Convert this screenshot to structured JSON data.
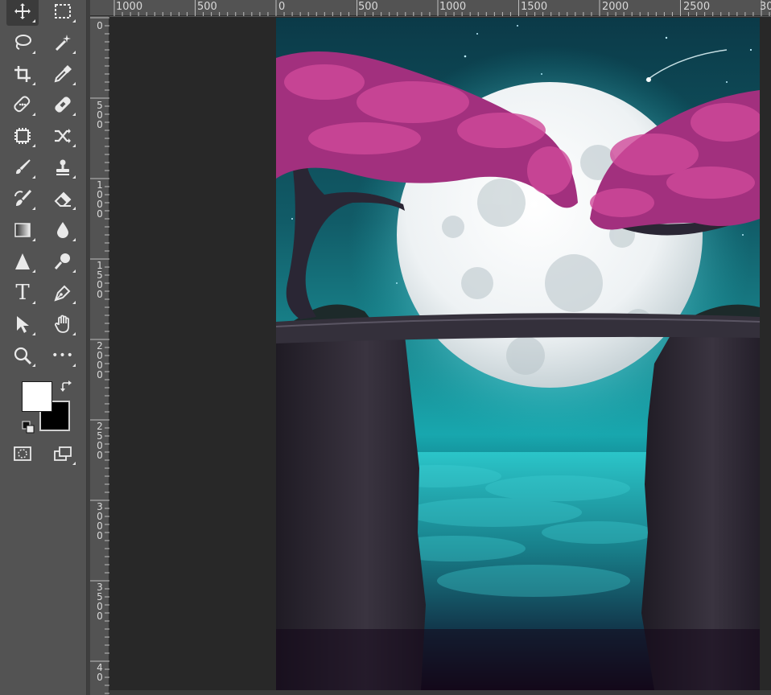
{
  "toolbar": {
    "tools": [
      {
        "name": "move-tool",
        "icon": "move-icon",
        "selected": true
      },
      {
        "name": "marquee-tool",
        "icon": "rectangular-marquee-icon"
      },
      {
        "name": "lasso-tool",
        "icon": "lasso-icon"
      },
      {
        "name": "magic-wand-tool",
        "icon": "magic-wand-icon"
      },
      {
        "name": "crop-tool",
        "icon": "crop-icon"
      },
      {
        "name": "eyedropper-tool",
        "icon": "eyedropper-icon"
      },
      {
        "name": "spot-healing-tool",
        "icon": "spot-healing-icon"
      },
      {
        "name": "healing-brush-tool",
        "icon": "bandage-icon"
      },
      {
        "name": "patch-tool",
        "icon": "patch-icon"
      },
      {
        "name": "content-aware-move-tool",
        "icon": "content-aware-move-icon"
      },
      {
        "name": "brush-tool",
        "icon": "brush-icon"
      },
      {
        "name": "clone-stamp-tool",
        "icon": "stamp-icon"
      },
      {
        "name": "history-brush-tool",
        "icon": "history-brush-icon"
      },
      {
        "name": "eraser-tool",
        "icon": "eraser-icon"
      },
      {
        "name": "gradient-tool",
        "icon": "gradient-icon"
      },
      {
        "name": "blur-tool",
        "icon": "droplet-icon"
      },
      {
        "name": "sharpen-tool",
        "icon": "triangle-icon"
      },
      {
        "name": "dodge-tool",
        "icon": "dodge-icon"
      },
      {
        "name": "type-tool",
        "icon": "type-icon",
        "label": "T"
      },
      {
        "name": "pen-tool",
        "icon": "pen-icon"
      },
      {
        "name": "path-selection-tool",
        "icon": "arrow-icon"
      },
      {
        "name": "hand-tool",
        "icon": "hand-icon"
      },
      {
        "name": "zoom-tool",
        "icon": "zoom-icon"
      },
      {
        "name": "more-tools",
        "icon": "ellipsis-icon",
        "label": "•••"
      }
    ],
    "foreground_color": "#ffffff",
    "background_color": "#000000"
  },
  "rulers": {
    "horizontal_labels": [
      "1000",
      "500",
      "0",
      "500",
      "1000",
      "1500",
      "2000",
      "2500",
      "30"
    ],
    "vertical_labels": [
      "0",
      "500",
      "1000",
      "1500",
      "2000",
      "2500",
      "3000",
      "3500",
      "40"
    ]
  },
  "colors": {
    "panel": "#535353",
    "pasteboard": "#282828",
    "sky_top": "#0b3a48",
    "glow": "#18a7ae",
    "blossom": "#c03c8a",
    "rock": "#2a2630"
  }
}
